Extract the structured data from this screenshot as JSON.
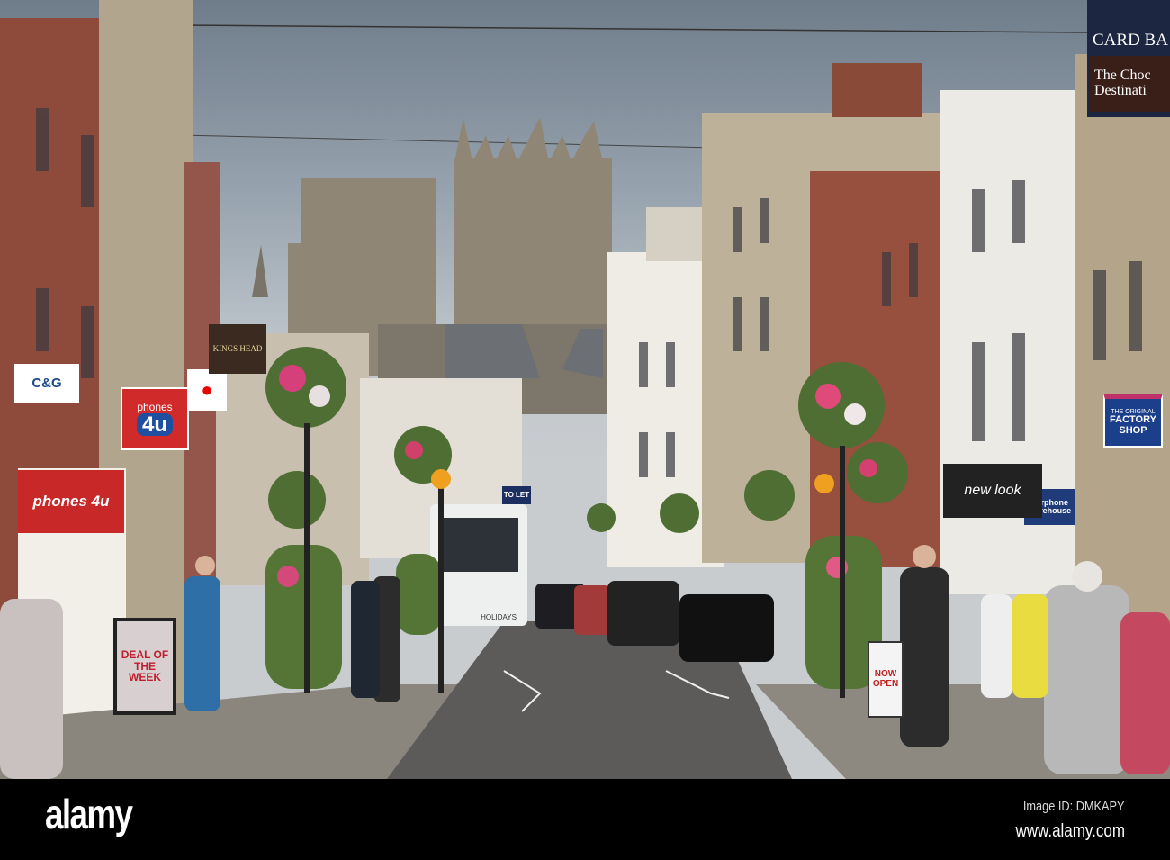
{
  "photo": {
    "subject": "High street with cathedral towers",
    "signs": {
      "card_shop": "CARD BA",
      "chocolate": "The Choc",
      "chocolate_line2": "Destinati",
      "cg": "C&G",
      "phones_top": "phones",
      "phones_num": "4u",
      "phones_shopfront": "phones 4u",
      "factory_small": "THE ORIGINAL",
      "factory_big": "FACTORY SHOP",
      "carphone": "Carphone Warehouse",
      "newlook": "new look",
      "deal": "DEAL OF THE WEEK",
      "to_let": "TO LET",
      "pub": "KINGS HEAD",
      "now_open": "NOW OPEN",
      "holidays": "HOLIDAYS"
    }
  },
  "watermark": {
    "logo": "alamy",
    "image_id": "Image ID: DMKAPY",
    "site": "www.alamy.com"
  }
}
